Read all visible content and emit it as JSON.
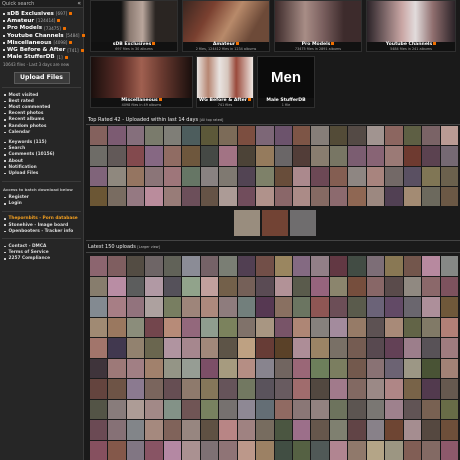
{
  "sidebar": {
    "quick_search_label": "Quick search",
    "collapse_icon": "«",
    "categories": [
      {
        "label": "sDB Exclusives",
        "count": "[697]"
      },
      {
        "label": "Amateur",
        "count": "[124414]"
      },
      {
        "label": "Pro Models",
        "count": "[73475]"
      },
      {
        "label": "Youtube Channels",
        "count": "[5484]"
      },
      {
        "label": "Miscellaneous",
        "count": "[4098]"
      },
      {
        "label": "WG Before & After",
        "count": "[741]"
      },
      {
        "label": "Male StufferDB",
        "count": "[1]"
      }
    ],
    "files_info": "10643 files · Last 3 days are new",
    "upload_label": "Upload Files",
    "nav_group_1": [
      "Most visited",
      "Best rated",
      "Most commented",
      "Recent photos",
      "Recent albums",
      "Random photos",
      "Calendar"
    ],
    "nav_group_2": [
      "Keywords (115)",
      "Search",
      "Comments (10156)",
      "About",
      "Notification",
      "Upload Files"
    ],
    "access_note": "Access to batch download below",
    "nav_group_3": [
      "Register",
      "Login"
    ],
    "nav_group_4": [
      {
        "label": "Thepornbits - Porn database",
        "orange": true
      },
      {
        "label": "Stonehive - Image board",
        "orange": false
      },
      {
        "label": "Openbooters - Tracker info",
        "orange": false
      }
    ],
    "nav_group_5": [
      "Contact - DMCA",
      "Terms of Service",
      "2257 Compliance"
    ]
  },
  "tiles": [
    {
      "name": "sDB Exclusives",
      "info": "697 files in 30 albums"
    },
    {
      "name": "Amateur",
      "info": "2 files, 124412 files in 1234 albums"
    },
    {
      "name": "Pro Models",
      "info": "73475 files in 2891 albums"
    },
    {
      "name": "Youtube Channels",
      "info": "5484 files in 241 albums"
    },
    {
      "name": "Miscellaneous",
      "info": "4098 files in 49 albums"
    },
    {
      "name": "WG Before & After",
      "info": "741 files"
    },
    {
      "name": "Male StufferDB",
      "info": "1 file",
      "overlay": "Men"
    }
  ],
  "top_rated": {
    "title": "Top Rated 42 - Uploaded within last 14 days",
    "link": "[All top rated]"
  },
  "latest": {
    "title": "Latest 150 uploads",
    "link": "[Larger view]"
  },
  "colors": {
    "rss": "#f07000",
    "accent_orange": "#f4a020",
    "bg": "#1a1a1a",
    "sidebar_bg": "#262626"
  }
}
